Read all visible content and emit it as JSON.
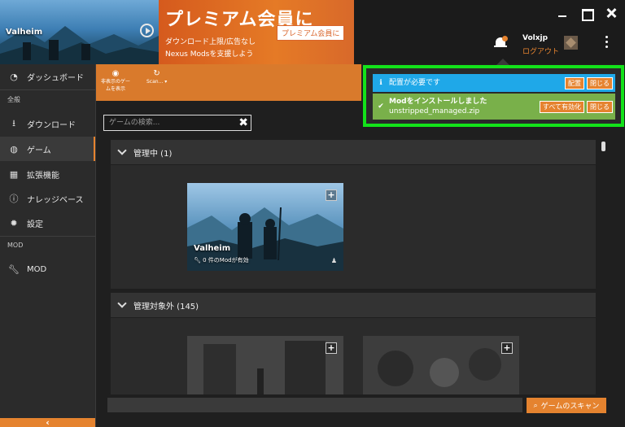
{
  "header": {
    "game_banner_title": "Valheim",
    "promo_title": "プレミアム会員に",
    "promo_line1": "ダウンロード上限/広告なし",
    "promo_line2": "Nexus Modsを支援しよう",
    "promo_cta": "プレミアム会員に",
    "username": "Volxjp",
    "logout": "ログアウト"
  },
  "sidebar": {
    "items": [
      {
        "label": "ダッシュボード",
        "icon": "dashboard-icon"
      },
      {
        "label": "ダウンロード",
        "icon": "download-icon"
      },
      {
        "label": "ゲーム",
        "icon": "gamepad-icon"
      },
      {
        "label": "拡張機能",
        "icon": "extensions-icon"
      },
      {
        "label": "ナレッジベース",
        "icon": "info-icon"
      },
      {
        "label": "設定",
        "icon": "settings-icon"
      },
      {
        "label": "MOD",
        "icon": "wrench-icon"
      }
    ],
    "section_general": "全般",
    "section_mod": "MOD",
    "active_index": 2
  },
  "toolbar": {
    "hide_games_label_1": "非表示のゲー",
    "hide_games_label_2": "ムを表示",
    "scan_label": "Scan..."
  },
  "main": {
    "search_placeholder": "ゲームの検索...",
    "managed_header": "管理中 (1)",
    "unmanaged_header": "管理対象外 (145)",
    "managed_tile": {
      "name": "Valheim",
      "mods": "0 件のModが有効"
    },
    "scan_button": "ゲームのスキャン"
  },
  "notifications": [
    {
      "type": "info",
      "text": "配置が必要です",
      "buttons": [
        "配置",
        "閉じる"
      ],
      "color": "#1fa8e8"
    },
    {
      "type": "success",
      "title": "Modをインストールしました",
      "detail": "unstripped_managed.zip",
      "buttons": [
        "すべて有効化",
        "閉じる"
      ],
      "color": "#79b04a"
    }
  ],
  "colors": {
    "accent": "#e5832f",
    "highlight_frame": "#13e21a"
  }
}
